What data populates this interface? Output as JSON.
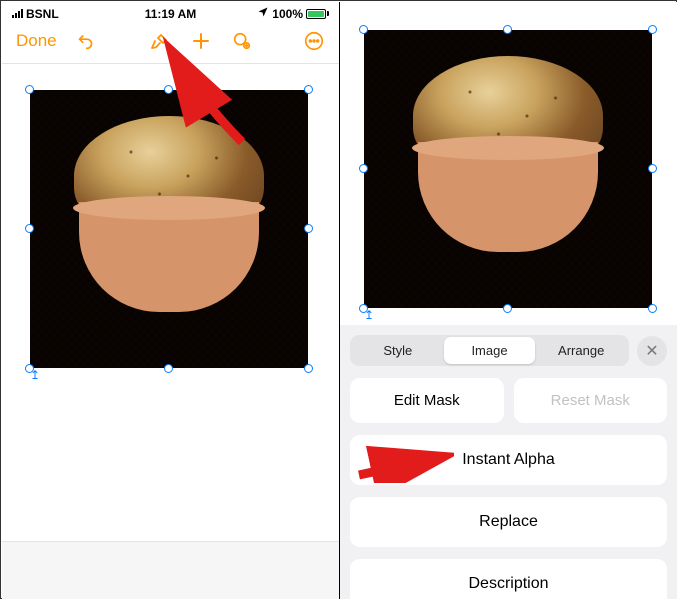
{
  "statusbar": {
    "carrier": "BSNL",
    "time": "11:19 AM",
    "battery_pct": "100%"
  },
  "toolbar": {
    "done": "Done"
  },
  "panel": {
    "tabs": {
      "style": "Style",
      "image": "Image",
      "arrange": "Arrange"
    },
    "edit_mask": "Edit Mask",
    "reset_mask": "Reset Mask",
    "instant_alpha": "Instant Alpha",
    "replace": "Replace",
    "description": "Description"
  }
}
